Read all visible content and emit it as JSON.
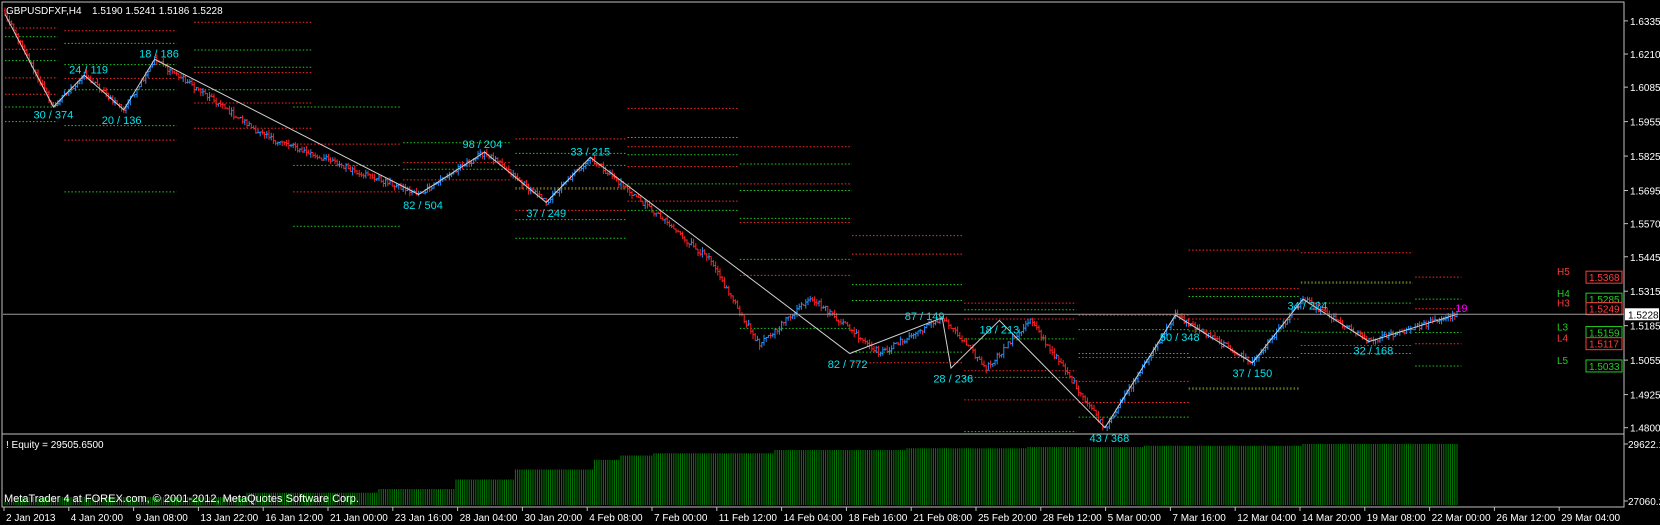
{
  "header": {
    "symbol": "GBPUSDFXF,H4",
    "ohlc": "1.5190 1.5241 1.5186 1.5228"
  },
  "indicator": {
    "label": "! Equity = 29505.6500",
    "ymax": "29622.1",
    "ymin": "27060.2"
  },
  "footer": {
    "copyright": "MetaTrader 4 at FOREX.com, © 2001-2012, MetaQuotes Software Corp."
  },
  "colors": {
    "background": "#000000",
    "frame": "#c0c0c0",
    "bull": "#1e90ff",
    "bear": "#ff2020",
    "zigzag": "#d0d0d0",
    "label": "#00e5ee",
    "level_red": "#ff2a2a",
    "level_green": "#22cc22",
    "equity": "#008000",
    "bid_line": "#9a9a9a",
    "pivot_label": "#ff3c3c",
    "magenta": "#ff00ff"
  },
  "chart_data": [
    {
      "type": "candlestick",
      "symbol": "GBPUSDFXF",
      "timeframe": "H4",
      "ylim": [
        1.478,
        1.6395
      ],
      "y_ticks": [
        "1.6335",
        "1.6210",
        "1.6085",
        "1.5955",
        "1.5825",
        "1.5695",
        "1.5570",
        "1.5445",
        "1.5315",
        "1.5185",
        "1.5055",
        "1.4925",
        "1.4800"
      ],
      "current_price": "1.5228",
      "x_ticks": [
        "2 Jan 2013",
        "4 Jan 20:00",
        "9 Jan 08:00",
        "13 Jan 22:00",
        "16 Jan 12:00",
        "21 Jan 00:00",
        "23 Jan 16:00",
        "28 Jan 04:00",
        "30 Jan 20:00",
        "4 Feb 08:00",
        "7 Feb 00:00",
        "11 Feb 12:00",
        "14 Feb 04:00",
        "18 Feb 16:00",
        "21 Feb 08:00",
        "25 Feb 20:00",
        "28 Feb 12:00",
        "5 Mar 00:00",
        "7 Mar 16:00",
        "12 Mar 04:00",
        "14 Mar 20:00",
        "19 Mar 08:00",
        "22 Mar 00:00",
        "26 Mar 12:00",
        "29 Mar 04:00"
      ],
      "price_path": [
        {
          "bar": 0,
          "price": 1.636
        },
        {
          "bar": 22,
          "price": 1.601
        },
        {
          "bar": 36,
          "price": 1.613
        },
        {
          "bar": 54,
          "price": 1.6
        },
        {
          "bar": 68,
          "price": 1.619
        },
        {
          "bar": 118,
          "price": 1.59
        },
        {
          "bar": 188,
          "price": 1.568
        },
        {
          "bar": 218,
          "price": 1.584
        },
        {
          "bar": 246,
          "price": 1.565
        },
        {
          "bar": 266,
          "price": 1.582
        },
        {
          "bar": 320,
          "price": 1.5435
        },
        {
          "bar": 343,
          "price": 1.511
        },
        {
          "bar": 366,
          "price": 1.5295
        },
        {
          "bar": 398,
          "price": 1.508
        },
        {
          "bar": 426,
          "price": 1.5215
        },
        {
          "bar": 446,
          "price": 1.5025
        },
        {
          "bar": 466,
          "price": 1.5205
        },
        {
          "bar": 500,
          "price": 1.48
        },
        {
          "bar": 532,
          "price": 1.5225
        },
        {
          "bar": 567,
          "price": 1.5045
        },
        {
          "bar": 590,
          "price": 1.5285
        },
        {
          "bar": 620,
          "price": 1.5125
        },
        {
          "bar": 660,
          "price": 1.5228
        }
      ],
      "zigzag": [
        {
          "bar": 0,
          "price": 1.636
        },
        {
          "bar": 22,
          "price": 1.601
        },
        {
          "bar": 36,
          "price": 1.613
        },
        {
          "bar": 54,
          "price": 1.6
        },
        {
          "bar": 68,
          "price": 1.619
        },
        {
          "bar": 188,
          "price": 1.568
        },
        {
          "bar": 218,
          "price": 1.584
        },
        {
          "bar": 246,
          "price": 1.565
        },
        {
          "bar": 266,
          "price": 1.582
        },
        {
          "bar": 384,
          "price": 1.508
        },
        {
          "bar": 426,
          "price": 1.5215
        },
        {
          "bar": 430,
          "price": 1.5025
        },
        {
          "bar": 452,
          "price": 1.5205
        },
        {
          "bar": 500,
          "price": 1.48
        },
        {
          "bar": 532,
          "price": 1.5225
        },
        {
          "bar": 567,
          "price": 1.5045
        },
        {
          "bar": 590,
          "price": 1.5285
        },
        {
          "bar": 620,
          "price": 1.5125
        },
        {
          "bar": 660,
          "price": 1.5228
        }
      ],
      "swing_labels": [
        {
          "text": "30 / 374",
          "bar": 22,
          "price": 1.6015,
          "pos": "below"
        },
        {
          "text": "24 / 119",
          "bar": 38,
          "price": 1.6125,
          "pos": "above"
        },
        {
          "text": "20 / 136",
          "bar": 53,
          "price": 1.5995,
          "pos": "below"
        },
        {
          "text": "18 / 186",
          "bar": 70,
          "price": 1.6185,
          "pos": "above"
        },
        {
          "text": "82 / 504",
          "bar": 190,
          "price": 1.5675,
          "pos": "below"
        },
        {
          "text": "98 / 204",
          "bar": 217,
          "price": 1.5845,
          "pos": "above"
        },
        {
          "text": "37 / 249",
          "bar": 246,
          "price": 1.5645,
          "pos": "below"
        },
        {
          "text": "33 / 215",
          "bar": 266,
          "price": 1.5815,
          "pos": "above"
        },
        {
          "text": "82 / 772",
          "bar": 383,
          "price": 1.5075,
          "pos": "below"
        },
        {
          "text": "87 / 149",
          "bar": 418,
          "price": 1.5195,
          "pos": "above"
        },
        {
          "text": "28 / 236",
          "bar": 431,
          "price": 1.502,
          "pos": "below"
        },
        {
          "text": "18 / 213",
          "bar": 452,
          "price": 1.5145,
          "pos": "above"
        },
        {
          "text": "43 / 368",
          "bar": 502,
          "price": 1.4795,
          "pos": "below"
        },
        {
          "text": "50 / 348",
          "bar": 534,
          "price": 1.5115,
          "pos": "above"
        },
        {
          "text": "37 / 150",
          "bar": 567,
          "price": 1.504,
          "pos": "below"
        },
        {
          "text": "34 / 224",
          "bar": 592,
          "price": 1.5235,
          "pos": "above"
        },
        {
          "text": "32 / 168",
          "bar": 622,
          "price": 1.5125,
          "pos": "below"
        },
        {
          "text": "19",
          "bar": 662,
          "price": 1.5225,
          "pos": "above"
        }
      ],
      "weekly_levels": [
        {
          "bar_start": 0,
          "bar_end": 24,
          "red": [
            1.6308,
            1.6228,
            1.612,
            1.6058
          ],
          "green": [
            1.6275,
            1.6185,
            1.601,
            1.5955
          ]
        },
        {
          "bar_start": 27,
          "bar_end": 78,
          "red": [
            1.6298,
            1.6118,
            1.5885
          ],
          "green": [
            1.625,
            1.617,
            1.6075,
            1.594,
            1.569
          ]
        },
        {
          "bar_start": 86,
          "bar_end": 140,
          "red": [
            1.633,
            1.614,
            1.6025,
            1.593
          ],
          "green": [
            1.6225,
            1.616,
            1.6075
          ]
        },
        {
          "bar_start": 131,
          "bar_end": 180,
          "red": [
            1.587,
            1.569
          ],
          "green": [
            1.601,
            1.579,
            1.556
          ]
        },
        {
          "bar_start": 181,
          "bar_end": 230,
          "red": [
            1.58,
            1.5735
          ],
          "green": [
            1.5875,
            1.5775
          ]
        },
        {
          "bar_start": 232,
          "bar_end": 282,
          "red": [
            1.589,
            1.57,
            1.562
          ],
          "green": [
            1.5835,
            1.579,
            1.5705,
            1.5585,
            1.5515
          ]
        },
        {
          "bar_start": 283,
          "bar_end": 333,
          "red": [
            1.6005,
            1.586,
            1.5785,
            1.5655
          ],
          "green": [
            1.5895,
            1.583,
            1.572,
            1.562
          ]
        },
        {
          "bar_start": 334,
          "bar_end": 385,
          "red": [
            1.586,
            1.572,
            1.5575,
            1.5375
          ],
          "green": [
            1.5795,
            1.5695,
            1.559,
            1.5435,
            1.5175
          ]
        },
        {
          "bar_start": 385,
          "bar_end": 435,
          "red": [
            1.5525,
            1.5455,
            1.5045
          ],
          "green": [
            1.534,
            1.528,
            1.5085
          ]
        },
        {
          "bar_start": 436,
          "bar_end": 487,
          "red": [
            1.527,
            1.521,
            1.5015,
            1.4905
          ],
          "green": [
            1.5245,
            1.5135,
            1.499,
            1.4785
          ]
        },
        {
          "bar_start": 488,
          "bar_end": 538,
          "red": [
            1.5225,
            1.5065,
            1.4975,
            1.4895
          ],
          "green": [
            1.517,
            1.508,
            1.484
          ]
        },
        {
          "bar_start": 538,
          "bar_end": 588,
          "red": [
            1.547,
            1.5325,
            1.521,
            1.4945
          ],
          "green": [
            1.5295,
            1.5165,
            1.5065,
            1.495
          ]
        },
        {
          "bar_start": 589,
          "bar_end": 640,
          "red": [
            1.546,
            1.5345,
            1.511
          ],
          "green": [
            1.535,
            1.527,
            1.516,
            1.508
          ]
        },
        {
          "bar_start": 641,
          "bar_end": 662,
          "red": [
            1.5368,
            1.5249,
            1.5117
          ],
          "green": [
            1.5285,
            1.5159,
            1.5033
          ]
        }
      ],
      "pivot_levels": [
        {
          "label": "H5",
          "value": "1.5368",
          "price": 1.5368,
          "color": "red"
        },
        {
          "label": "H4",
          "value": "1.5285",
          "price": 1.5285,
          "color": "green"
        },
        {
          "label": "H3",
          "value": "1.5249",
          "price": 1.5249,
          "color": "red"
        },
        {
          "label": "L3",
          "value": "1.5159",
          "price": 1.5159,
          "color": "green"
        },
        {
          "label": "L4",
          "value": "1.5117",
          "price": 1.5117,
          "color": "red"
        },
        {
          "label": "L5",
          "value": "1.5033",
          "price": 1.5033,
          "color": "green"
        }
      ]
    },
    {
      "type": "bar",
      "name": "Equity",
      "ylim": [
        27060.2,
        29622.1
      ],
      "steps": [
        {
          "bar": 0,
          "value": 27180
        },
        {
          "bar": 5,
          "value": 27380
        },
        {
          "bar": 110,
          "value": 27550
        },
        {
          "bar": 170,
          "value": 27700
        },
        {
          "bar": 205,
          "value": 28080
        },
        {
          "bar": 232,
          "value": 28480
        },
        {
          "bar": 268,
          "value": 28870
        },
        {
          "bar": 280,
          "value": 29040
        },
        {
          "bar": 295,
          "value": 29130
        },
        {
          "bar": 350,
          "value": 29260
        },
        {
          "bar": 410,
          "value": 29330
        },
        {
          "bar": 465,
          "value": 29380
        },
        {
          "bar": 518,
          "value": 29430
        },
        {
          "bar": 590,
          "value": 29505.65
        }
      ]
    }
  ]
}
